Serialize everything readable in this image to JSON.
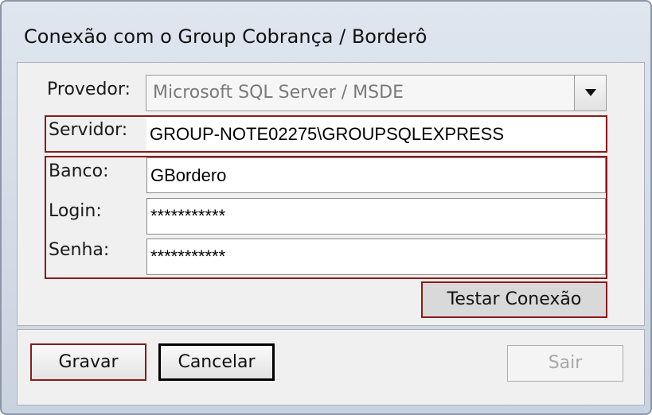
{
  "window": {
    "title": "Conexão com o Group Cobrança / Borderô"
  },
  "form": {
    "provedor_label": "Provedor:",
    "provedor_value": "Microsoft SQL Server / MSDE",
    "servidor_label": "Servidor:",
    "servidor_value": "GROUP-NOTE02275\\GROUPSQLEXPRESS",
    "banco_label": "Banco:",
    "banco_value": "GBordero",
    "login_label": "Login:",
    "login_value": "***********",
    "senha_label": "Senha:",
    "senha_value": "***********"
  },
  "buttons": {
    "test_connection": "Testar Conexão",
    "save": "Gravar",
    "cancel": "Cancelar",
    "exit": "Sair"
  },
  "icons": {
    "dropdown": "chevron-down-icon"
  },
  "colors": {
    "highlight": "#8b1a1a",
    "disabled_text": "#a8a8a8"
  }
}
